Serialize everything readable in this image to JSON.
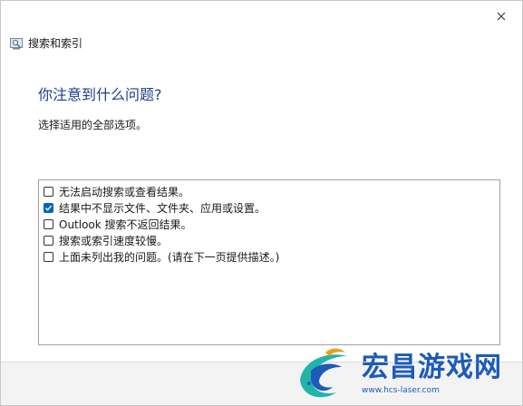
{
  "window": {
    "title": "搜索和索引",
    "close_icon": "close-icon"
  },
  "main": {
    "heading": "你注意到什么问题?",
    "instruction": "选择适用的全部选项。",
    "options": [
      {
        "label": "无法启动搜索或查看结果。",
        "checked": false
      },
      {
        "label": "结果中不显示文件、文件夹、应用或设置。",
        "checked": true
      },
      {
        "label": "Outlook 搜索不返回结果。",
        "checked": false
      },
      {
        "label": "搜索或索引速度较慢。",
        "checked": false
      },
      {
        "label": "上面未列出我的问题。(请在下一页提供描述。)",
        "checked": false
      }
    ]
  },
  "watermark": {
    "title": "宏昌游戏网",
    "url": "www.hcs-laser.com"
  },
  "colors": {
    "heading": "#1e3f87",
    "accent": "#0067c0",
    "watermark": "#1e5bb8"
  }
}
